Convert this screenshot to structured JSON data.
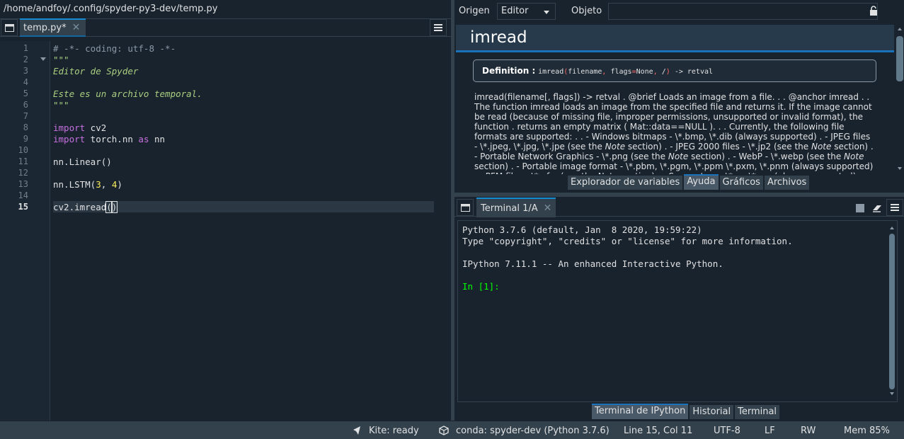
{
  "editor": {
    "path": "/home/andfoy/.config/spyder-py3-dev/temp.py",
    "tab_label": "temp.py*",
    "line_numbers": [
      "1",
      "2",
      "3",
      "4",
      "5",
      "6",
      "7",
      "8",
      "9",
      "10",
      "11",
      "12",
      "13",
      "14",
      "15"
    ],
    "lines": [
      "# -*- coding: utf-8 -*-",
      "\"\"\"",
      "Editor de Spyder",
      "",
      "Este es un archivo temporal.",
      "\"\"\"",
      "",
      "import cv2",
      "import torch.nn as nn",
      "",
      "nn.Linear()",
      "",
      "nn.LSTM(3, 4)",
      "",
      "cv2.imread()"
    ],
    "tokens": {
      "kw_import": "import",
      "kw_as": "as",
      "mod_cv2": " cv2",
      "mod_torch": " torch.nn ",
      "alias_nn": " nn",
      "lstm_prefix": "nn.LSTM(",
      "num_3": "3",
      "comma_sep": ", ",
      "num_4": "4",
      "close_paren": ")",
      "imread_prefix": "cv2.imread",
      "open_paren": "(",
      "close_paren_cursor": ")"
    }
  },
  "help": {
    "source_label": "Origen",
    "source_value": "Editor",
    "object_label": "Objeto",
    "object_value": "",
    "title": "imread",
    "definition_label": "Definition :",
    "sig_name": "imread",
    "sig_p1": "(",
    "sig_a1": "filename",
    "sig_p2": ",",
    "sig_a2": " flags",
    "sig_p3": "=",
    "sig_a3": "None",
    "sig_p4": ",",
    "sig_a4": " /",
    "sig_p5": ")",
    "sig_ret": " -> retval",
    "doc_1": "imread(filename[, flags]) -> retval . @brief Loads an image from a file. . . @anchor imread . . The function imread loads an image from the specified file and returns it. If the image cannot be read (because of missing file, improper permissions, unsupported or invalid format), the function . returns an empty matrix ( Mat::data==NULL ). . . Currently, the following file formats are supported: . . - Windows bitmaps - \\*.bmp, \\*.dib (always supported) . - JPEG files - \\*.jpeg, \\*.jpg, \\*.jpe (see the ",
    "doc_note": "Note",
    "doc_2": " section) . - JPEG 2000 files - \\*.jp2 (see the ",
    "doc_3": " section) . - Portable Network Graphics - \\*.png (see the ",
    "doc_4": " section) . - WebP - \\*.webp (see the ",
    "doc_5": " section) . - Portable image format - \\*.pbm, \\*.pgm, \\*.ppm \\*.pxm, \\*.pnm (always supported) . - PFM files - \\*.pfm (see the Note section) . - Sun rasters - \\*.sr, \\*.ras (always supported) . - TIFF files - \\*.tiff",
    "tabs": [
      "Explorador de variables",
      "Ayuda",
      "Gráficos",
      "Archivos"
    ]
  },
  "console": {
    "tab_label": "Terminal 1/A",
    "lines": [
      "Python 3.7.6 (default, Jan  8 2020, 19:59:22)",
      "Type \"copyright\", \"credits\" or \"license\" for more information.",
      "",
      "IPython 7.11.1 -- An enhanced Interactive Python.",
      ""
    ],
    "prompt": "In [1]:",
    "tabs": [
      "Terminal de IPython",
      "Historial",
      "Terminal"
    ]
  },
  "status": {
    "kite": "Kite: ready",
    "conda": "conda: spyder-dev (Python 3.7.6)",
    "position": "Line 15, Col 11",
    "encoding": "UTF-8",
    "eol": "LF",
    "permissions": "RW",
    "memory": "Mem 85%"
  },
  "colors": {
    "background": "#19232d",
    "panel": "#32414b",
    "accent": "#1a72bb",
    "keyword": "#c670e0",
    "number": "#faed5c",
    "docstring": "#aacf80",
    "prompt": "#00ff00"
  }
}
